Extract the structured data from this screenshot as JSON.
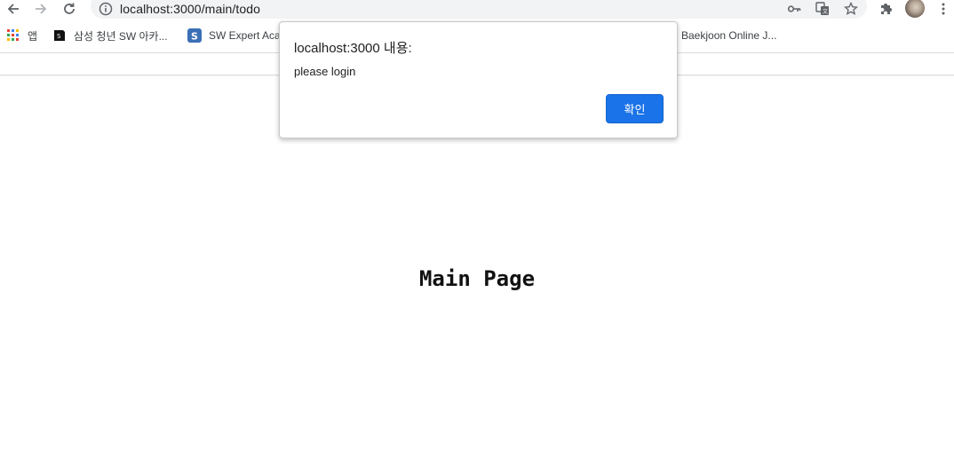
{
  "browser": {
    "url": "localhost:3000/main/todo"
  },
  "bookmarks": [
    {
      "label": "앱",
      "icon": "apps-grid-icon"
    },
    {
      "label": "삼성 청년 SW 아카...",
      "icon": "ssafy-favicon"
    },
    {
      "label": "SW Expert Aca",
      "icon": "swea-favicon"
    },
    {
      "label": "Baekjoon Online J...",
      "icon": "baekjoon-favicon"
    }
  ],
  "page": {
    "title": "Main Page"
  },
  "dialog": {
    "title": "localhost:3000 내용:",
    "message": "please login",
    "confirm_label": "확인"
  },
  "colors": {
    "accent": "#1a73e8",
    "toolbar_bg": "#f1f3f4"
  }
}
